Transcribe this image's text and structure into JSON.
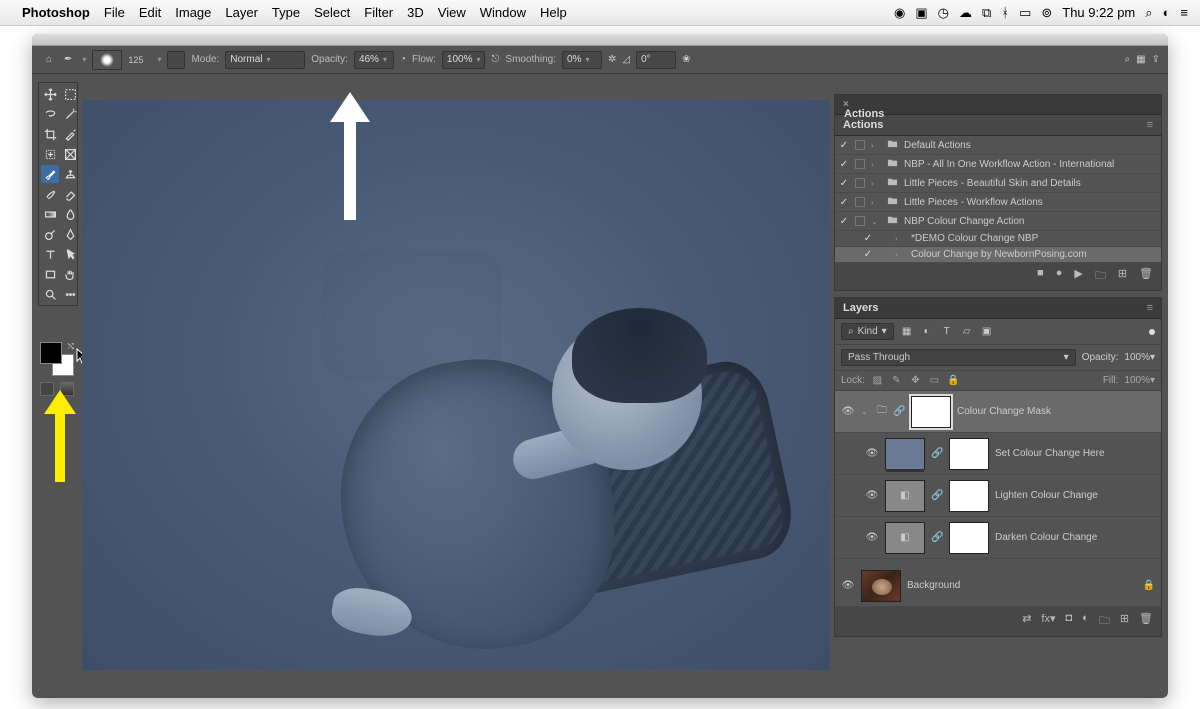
{
  "menubar": {
    "app": "Photoshop",
    "items": [
      "File",
      "Edit",
      "Image",
      "Layer",
      "Type",
      "Select",
      "Filter",
      "3D",
      "View",
      "Window",
      "Help"
    ],
    "clock": "Thu 9:22 pm"
  },
  "optbar": {
    "brush_size": "125",
    "mode_label": "Mode:",
    "mode_value": "Normal",
    "opacity_label": "Opacity:",
    "opacity_value": "46%",
    "flow_label": "Flow:",
    "flow_value": "100%",
    "smoothing_label": "Smoothing:",
    "smoothing_value": "0%",
    "angle_value": "0°"
  },
  "actions_panel": {
    "title": "Actions",
    "items": [
      {
        "checked": "✓",
        "box": true,
        "disclosure": "›",
        "folder": true,
        "name": "Default Actions"
      },
      {
        "checked": "✓",
        "box": true,
        "disclosure": "›",
        "folder": true,
        "name": "NBP - All In One Workflow Action - International"
      },
      {
        "checked": "✓",
        "box": true,
        "disclosure": "›",
        "folder": true,
        "name": "Little Pieces - Beautiful Skin and Details"
      },
      {
        "checked": "✓",
        "box": true,
        "disclosure": "›",
        "folder": true,
        "name": "Little Pieces - Workflow Actions"
      },
      {
        "checked": "✓",
        "box": true,
        "disclosure": "⌄",
        "folder": true,
        "name": "NBP Colour Change Action"
      },
      {
        "checked": "✓",
        "box": false,
        "disclosure": "›",
        "folder": false,
        "name": "*DEMO Colour Change NBP",
        "indent": true
      },
      {
        "checked": "✓",
        "box": false,
        "disclosure": "›",
        "folder": false,
        "name": "Colour Change by NewbornPosing.com",
        "indent": true,
        "selected": true
      }
    ]
  },
  "layers_panel": {
    "title": "Layers",
    "kind_label": "Kind",
    "blend_mode": "Pass Through",
    "opacity_label": "Opacity:",
    "opacity_value": "100%",
    "lock_label": "Lock:",
    "fill_label": "Fill:",
    "fill_value": "100%",
    "layers": [
      {
        "name": "Colour Change Mask",
        "type": "group",
        "selected": true,
        "mask": true,
        "disclosure": "⌄"
      },
      {
        "name": "Set Colour Change Here",
        "type": "solid",
        "mask": true,
        "indent": 1,
        "link": true
      },
      {
        "name": "Lighten Colour Change",
        "type": "adj",
        "mask": true,
        "indent": 1,
        "link": true
      },
      {
        "name": "Darken Colour Change",
        "type": "adj",
        "mask": true,
        "indent": 1,
        "link": true
      },
      {
        "name": "Background",
        "type": "bg",
        "locked": true
      }
    ]
  },
  "colors": {
    "fg": "#000000",
    "bg": "#ffffff",
    "canvas_tint": "#4a5b76"
  }
}
